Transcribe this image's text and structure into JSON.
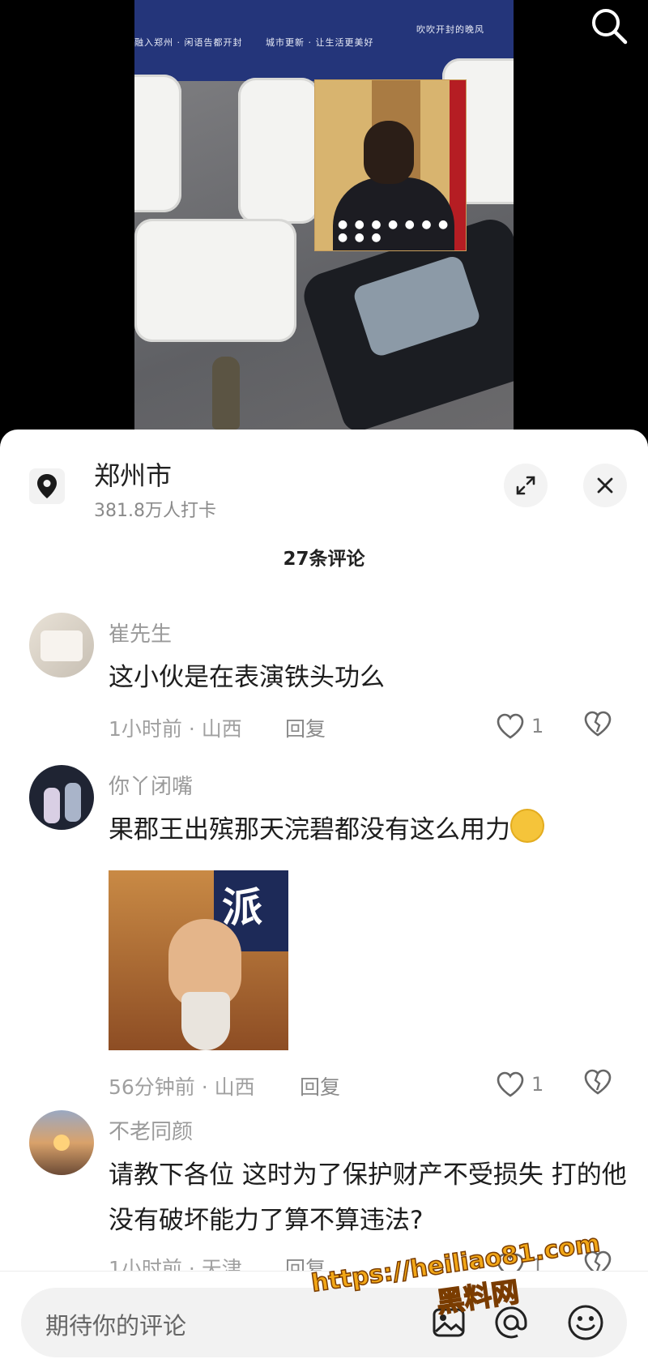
{
  "video": {
    "banner_texts": [
      "融入郑州 · 闲语告都开封",
      "城市更新 · 让生活更美好",
      "吹吹开封的晚风"
    ]
  },
  "location": {
    "title": "郑州市",
    "subtitle": "381.8万人打卡"
  },
  "comments_count": "27条评论",
  "comments": [
    {
      "user": "崔先生",
      "text": "这小伙是在表演铁头功么",
      "meta": "1小时前 · 山西",
      "reply": "回复",
      "likes": "1"
    },
    {
      "user": "你丫闭嘴",
      "text": "果郡王出殡那天浣碧都没有这么用力",
      "meta": "56分钟前 · 山西",
      "reply": "回复",
      "likes": "1",
      "image_caption": "派"
    },
    {
      "user": "不老同颜",
      "text": "请教下各位 这时为了保护财产不受损失 打的他没有破坏能力了算不算违法?",
      "meta": "1小时前 · 天津",
      "reply": "回复",
      "likes": "1"
    }
  ],
  "input": {
    "placeholder": "期待你的评论"
  },
  "watermark": {
    "url": "https://heiliao81.com",
    "name": "黑料网"
  },
  "icons": {
    "search": "search-icon",
    "location": "location-pin-icon",
    "expand": "expand-icon",
    "close": "close-icon",
    "like": "heart-icon",
    "dislike": "broken-heart-icon",
    "image": "image-icon",
    "at": "at-icon",
    "emoji": "emoji-icon"
  }
}
